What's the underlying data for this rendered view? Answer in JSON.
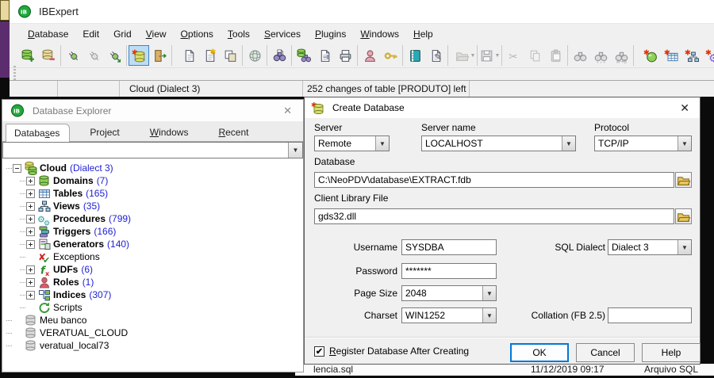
{
  "window": {
    "title": "IBExpert",
    "app_icon": "ibexpert-logo-icon"
  },
  "menu": {
    "items": [
      {
        "label": "Database",
        "accel": 0
      },
      {
        "label": "Edit",
        "accel": -1
      },
      {
        "label": "Grid",
        "accel": -1
      },
      {
        "label": "View",
        "accel": 0
      },
      {
        "label": "Options",
        "accel": 0
      },
      {
        "label": "Tools",
        "accel": 0
      },
      {
        "label": "Services",
        "accel": 0
      },
      {
        "label": "Plugins",
        "accel": 0
      },
      {
        "label": "Windows",
        "accel": 0
      },
      {
        "label": "Help",
        "accel": 0
      }
    ]
  },
  "toolbar": {
    "groups": [
      {
        "grip": true,
        "items": [
          {
            "icon": "register-database"
          },
          {
            "icon": "unregister-database"
          }
        ]
      },
      {
        "items": [
          {
            "icon": "connect"
          },
          {
            "icon": "disconnect",
            "disabled": true
          },
          {
            "icon": "test-connection"
          }
        ]
      },
      {
        "items": [
          {
            "icon": "create-database",
            "selected": true
          },
          {
            "icon": "exit-application"
          }
        ]
      },
      {
        "grip": true,
        "items": [
          {
            "icon": "new-sql-editor"
          },
          {
            "icon": "new-script"
          },
          {
            "icon": "copy-objects"
          }
        ]
      },
      {
        "items": [
          {
            "icon": "localization"
          }
        ]
      },
      {
        "items": [
          {
            "icon": "search-in-metadata"
          }
        ]
      },
      {
        "items": [
          {
            "icon": "extract-metadata"
          },
          {
            "icon": "script-generator"
          },
          {
            "icon": "print"
          }
        ]
      },
      {
        "items": [
          {
            "icon": "user-manager"
          },
          {
            "icon": "grant-manager"
          }
        ]
      },
      {
        "items": [
          {
            "icon": "blob-viewer"
          },
          {
            "icon": "sql-editor-edit"
          }
        ]
      },
      {
        "grip": true,
        "items": [
          {
            "icon": "open-file",
            "disabled": true,
            "dropdown": true
          }
        ]
      },
      {
        "items": [
          {
            "icon": "save-file",
            "disabled": true,
            "dropdown": true
          }
        ]
      },
      {
        "items": [
          {
            "icon": "cut",
            "disabled": true
          },
          {
            "icon": "copy",
            "disabled": true
          },
          {
            "icon": "paste",
            "disabled": true
          }
        ]
      },
      {
        "items": [
          {
            "icon": "find",
            "disabled": true
          },
          {
            "icon": "find-next",
            "disabled": true
          },
          {
            "icon": "replace",
            "disabled": true
          }
        ]
      },
      {
        "grip": true,
        "nosep": true,
        "items": [
          {
            "icon": "new-domain"
          },
          {
            "icon": "new-table"
          },
          {
            "icon": "new-view"
          },
          {
            "icon": "new-procedure"
          },
          {
            "icon": "new-trigger"
          },
          {
            "icon": "new-generator"
          },
          {
            "icon": "new-check-constraint"
          }
        ]
      }
    ]
  },
  "statusbar": {
    "cells": [
      "",
      "",
      "Cloud (Dialect 3)",
      "252 changes of table [PRODUTO] left",
      ""
    ]
  },
  "background_file_row": {
    "name": "lencia.sql",
    "date": "11/12/2019 09:17",
    "type": "Arquivo SQL"
  },
  "explorer": {
    "title": "Database Explorer",
    "close_glyph": "✕",
    "tabs": [
      {
        "label": "Databases",
        "accel": 6,
        "active": true
      },
      {
        "label": "Project",
        "accel": 3,
        "active": false
      },
      {
        "label": "Windows",
        "accel": 0,
        "active": false
      },
      {
        "label": "Recent",
        "accel": 0,
        "active": false
      }
    ],
    "filter_combo_value": "",
    "tree": [
      {
        "label": "Cloud",
        "count": "(Dialect 3)",
        "icon": "database-active",
        "level": 0,
        "expander": "minus",
        "bold": true
      },
      {
        "label": "Domains",
        "count": "(7)",
        "icon": "domain",
        "level": 1,
        "expander": "plus",
        "bold": true
      },
      {
        "label": "Tables",
        "count": "(165)",
        "icon": "table",
        "level": 1,
        "expander": "plus",
        "bold": true
      },
      {
        "label": "Views",
        "count": "(35)",
        "icon": "view",
        "level": 1,
        "expander": "plus",
        "bold": true
      },
      {
        "label": "Procedures",
        "count": "(799)",
        "icon": "procedure",
        "level": 1,
        "expander": "plus",
        "bold": true
      },
      {
        "label": "Triggers",
        "count": "(166)",
        "icon": "trigger",
        "level": 1,
        "expander": "plus",
        "bold": true
      },
      {
        "label": "Generators",
        "count": "(140)",
        "icon": "generator",
        "level": 1,
        "expander": "plus",
        "bold": true
      },
      {
        "label": "Exceptions",
        "count": "",
        "icon": "exception",
        "level": 1,
        "expander": "none",
        "bold": false
      },
      {
        "label": "UDFs",
        "count": "(6)",
        "icon": "udf",
        "level": 1,
        "expander": "plus",
        "bold": true
      },
      {
        "label": "Roles",
        "count": "(1)",
        "icon": "role",
        "level": 1,
        "expander": "plus",
        "bold": true
      },
      {
        "label": "Indices",
        "count": "(307)",
        "icon": "index",
        "level": 1,
        "expander": "plus",
        "bold": true
      },
      {
        "label": "Scripts",
        "count": "",
        "icon": "script",
        "level": 1,
        "expander": "none",
        "bold": false
      },
      {
        "label": "Meu banco",
        "count": "",
        "icon": "database-offline",
        "level": 0,
        "expander": "none",
        "bold": false
      },
      {
        "label": "VERATUAL_CLOUD",
        "count": "",
        "icon": "database-offline",
        "level": 0,
        "expander": "none",
        "bold": false
      },
      {
        "label": "veratual_local73",
        "count": "",
        "icon": "database-offline",
        "level": 0,
        "expander": "none",
        "bold": false
      }
    ]
  },
  "dialog": {
    "title": "Create Database",
    "title_icon": "new-database-icon",
    "close_glyph": "✕",
    "fields": {
      "server": {
        "label": "Server",
        "value": "Remote"
      },
      "server_name": {
        "label": "Server name",
        "value": "LOCALHOST"
      },
      "protocol": {
        "label": "Protocol",
        "value": "TCP/IP"
      },
      "database": {
        "label": "Database",
        "value": "C:\\NeoPDV\\database\\EXTRACT.fdb"
      },
      "client_library": {
        "label": "Client Library File",
        "value": "gds32.dll"
      },
      "username": {
        "label": "Username",
        "value": "SYSDBA"
      },
      "sql_dialect": {
        "label": "SQL Dialect",
        "value": "Dialect 3"
      },
      "password": {
        "label": "Password",
        "value": "*******"
      },
      "page_size": {
        "label": "Page Size",
        "value": "2048"
      },
      "charset": {
        "label": "Charset",
        "value": "WIN1252"
      },
      "collation": {
        "label": "Collation (FB 2.5)",
        "value": ""
      }
    },
    "register_checkbox": {
      "label": "Register Database After Creating",
      "accel": 0,
      "checked": true,
      "check_glyph": "✔"
    },
    "buttons": {
      "ok": "OK",
      "cancel": "Cancel",
      "help": "Help"
    },
    "accent_color": "#0078d7"
  }
}
